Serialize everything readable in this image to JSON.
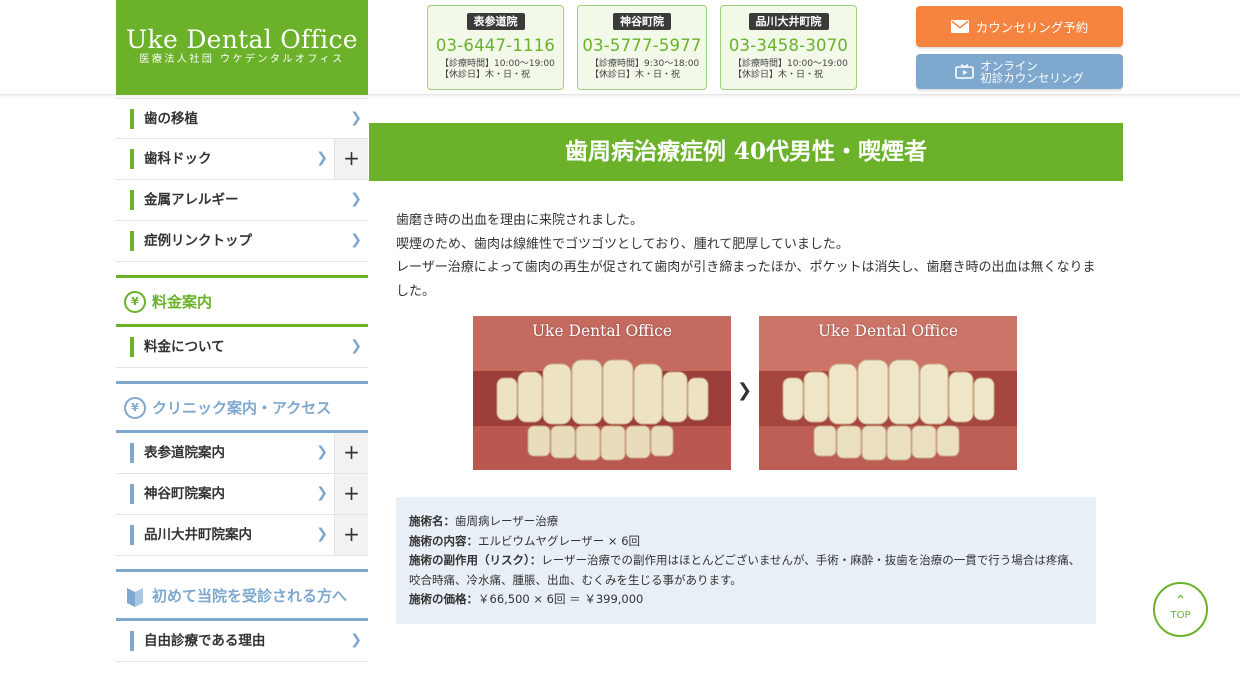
{
  "header": {
    "logo_main": "Uke Dental Office",
    "logo_sub": "医療法人社団 ウケデンタルオフィス",
    "branches": [
      {
        "name": "表参道院",
        "tel": "03-6447-1116",
        "hours": "【診療時間】10:00〜19:00",
        "closed": "【休診日】木・日・祝"
      },
      {
        "name": "神谷町院",
        "tel": "03-5777-5977",
        "hours": "【診療時間】9:30〜18:00",
        "closed": "【休診日】木・日・祝"
      },
      {
        "name": "品川大井町院",
        "tel": "03-3458-3070",
        "hours": "【診療時間】10:00〜19:00",
        "closed": "【休診日】木・日・祝"
      }
    ],
    "counsel_label": "カウンセリング予約",
    "online_line1": "オンライン",
    "online_line2": "初診カウンセリング"
  },
  "sidebar": {
    "items_top": [
      {
        "label": "歯の移植"
      },
      {
        "label": "歯科ドック"
      },
      {
        "label": "金属アレルギー"
      },
      {
        "label": "症例リンクトップ"
      }
    ],
    "price_section": {
      "icon": "¥",
      "title": "料金案内"
    },
    "price_items": [
      {
        "label": "料金について"
      }
    ],
    "clinic_section": {
      "icon": "¥",
      "title": "クリニック案内・アクセス"
    },
    "clinic_items": [
      {
        "label": "表参道院案内"
      },
      {
        "label": "神谷町院案内"
      },
      {
        "label": "品川大井町院案内"
      }
    ],
    "first_section": {
      "title": "初めて当院を受診される方へ"
    },
    "first_items": [
      {
        "label": "自由診療である理由"
      }
    ]
  },
  "main": {
    "title": "歯周病治療症例 40代男性・喫煙者",
    "desc": [
      "歯磨き時の出血を理由に来院されました。",
      "喫煙のため、歯肉は線維性でゴツゴツとしており、腫れて肥厚していました。",
      "レーザー治療によって歯肉の再生が促されて歯肉が引き締まったほか、ポケットは消失し、歯磨き時の出血は無くなりました。"
    ],
    "photo_caption": "Uke Dental Office",
    "info": {
      "name_label": "施術名：",
      "name_value": "歯周病レーザー治療",
      "content_label": "施術の内容：",
      "content_value": "エルビウムヤグレーザー × 6回",
      "risk_label": "施術の副作用（リスク）：",
      "risk_value": "レーザー治療での副作用はほとんどございませんが、手術・麻酔・抜歯を治療の一貫で行う場合は疼痛、咬合時痛、冷水痛、腫脹、出血、むくみを生じる事があります。",
      "price_label": "施術の価格：",
      "price_value": "￥66,500 × 6回 ＝ ￥399,000"
    }
  },
  "top_button": "TOP",
  "colors": {
    "green": "#6bb22a",
    "blue": "#7fa8cf",
    "orange": "#f4843f"
  }
}
